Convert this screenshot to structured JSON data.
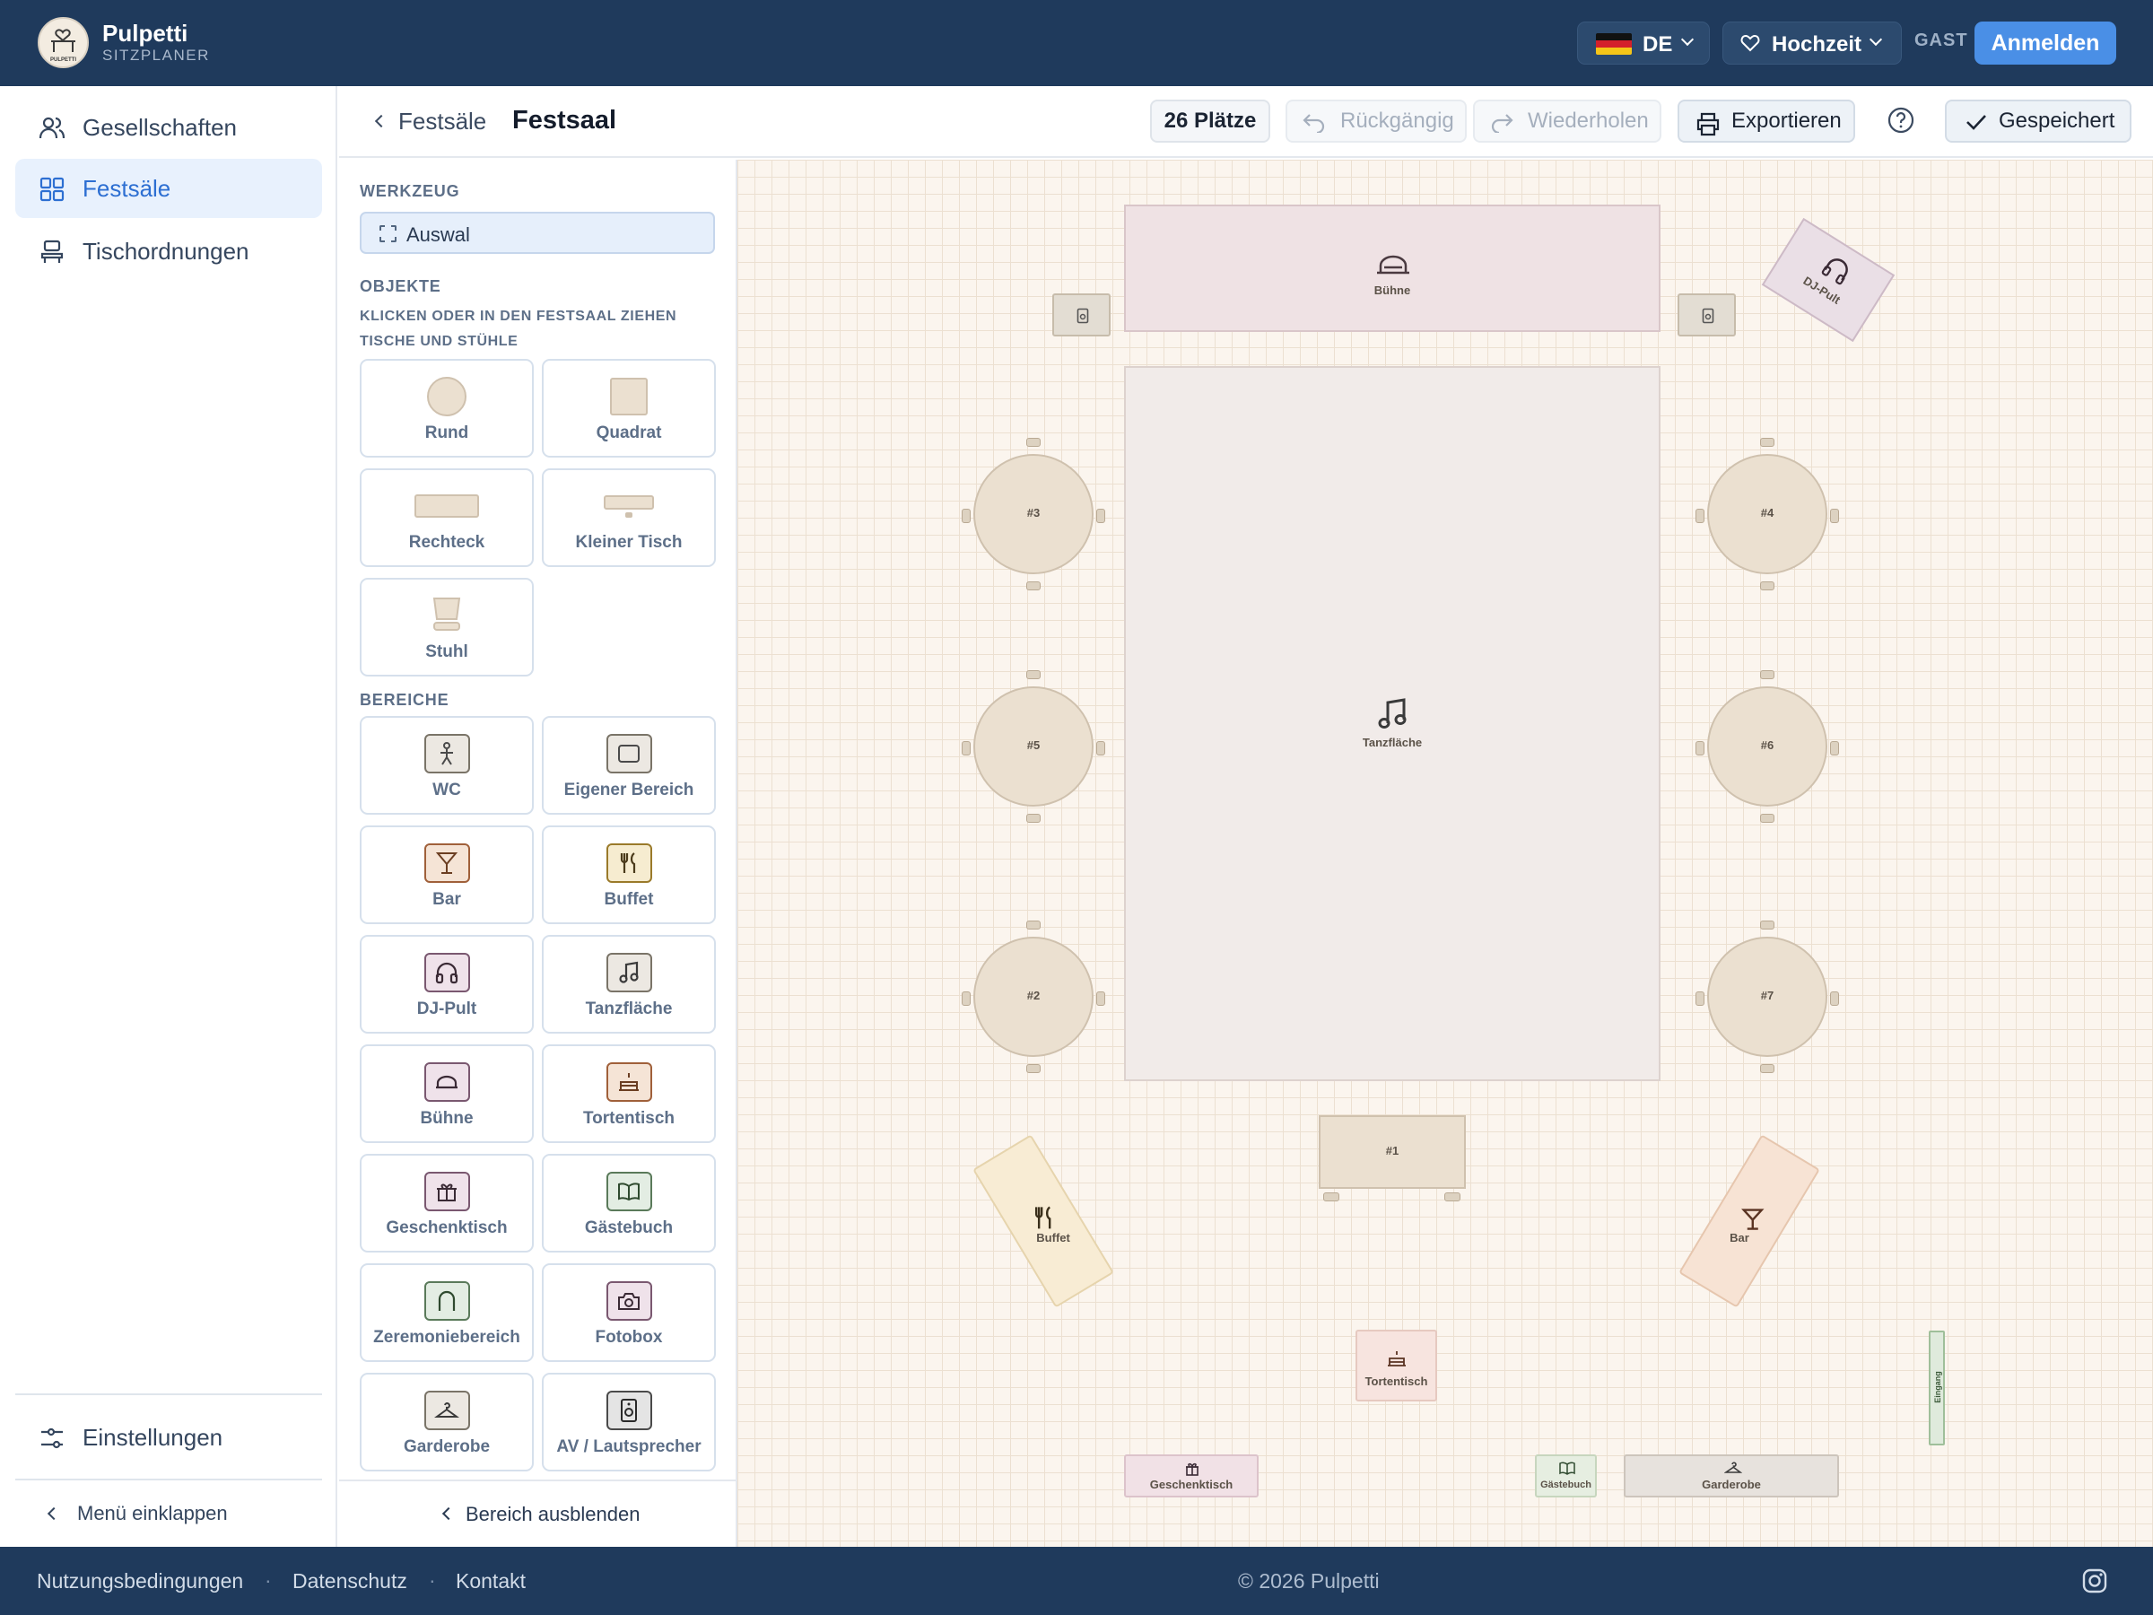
{
  "brand": {
    "name": "Pulpetti",
    "subtitle": "SITZPLANER",
    "logo_text": "PULPETTI"
  },
  "topbar": {
    "language": "DE",
    "event_type": "Hochzeit",
    "guest_label": "GAST",
    "login_label": "Anmelden"
  },
  "nav": {
    "items": [
      {
        "label": "Gesellschaften",
        "icon": "users-icon",
        "active": false
      },
      {
        "label": "Festsäle",
        "icon": "grid-icon",
        "active": true
      },
      {
        "label": "Tischordnungen",
        "icon": "chair-icon",
        "active": false
      }
    ],
    "settings_label": "Einstellungen",
    "collapse_label": "Menü einklappen"
  },
  "subheader": {
    "back_label": "Festsäle",
    "title": "Festsaal",
    "seats": "26 Plätze",
    "undo": "Rückgängig",
    "redo": "Wiederholen",
    "export": "Exportieren",
    "saved": "Gespeichert"
  },
  "tools": {
    "tool_title": "WERKZEUG",
    "selection": "Auswal",
    "objects_title": "OBJEKTE",
    "drag_hint": "KLICKEN ODER IN DEN FESTSAAL ZIEHEN",
    "tables_title": "TISCHE UND STÜHLE",
    "tables": [
      "Rund",
      "Quadrat",
      "Rechteck",
      "Kleiner Tisch",
      "Stuhl"
    ],
    "areas_title": "BEREICHE",
    "areas": [
      {
        "label": "WC",
        "icon": "wc-icon",
        "color": "#7a7468"
      },
      {
        "label": "Eigener Bereich",
        "icon": "square-icon",
        "color": "#7a7468"
      },
      {
        "label": "Bar",
        "icon": "cocktail-icon",
        "color": "#a0603a"
      },
      {
        "label": "Buffet",
        "icon": "cutlery-icon",
        "color": "#9a7a2a"
      },
      {
        "label": "DJ-Pult",
        "icon": "headphones-icon",
        "color": "#7a5870"
      },
      {
        "label": "Tanzfläche",
        "icon": "music-icon",
        "color": "#7a7468"
      },
      {
        "label": "Bühne",
        "icon": "stage-icon",
        "color": "#7a5870"
      },
      {
        "label": "Tortentisch",
        "icon": "cake-icon",
        "color": "#a0603a"
      },
      {
        "label": "Geschenktisch",
        "icon": "gift-icon",
        "color": "#7a5870"
      },
      {
        "label": "Gästebuch",
        "icon": "book-icon",
        "color": "#5a7a5a"
      },
      {
        "label": "Zeremoniebereich",
        "icon": "arch-icon",
        "color": "#5a7a5a"
      },
      {
        "label": "Fotobox",
        "icon": "camera-icon",
        "color": "#7a5870"
      },
      {
        "label": "Garderobe",
        "icon": "hanger-icon",
        "color": "#7a7468"
      },
      {
        "label": "AV / Lautsprecher",
        "icon": "speaker-icon",
        "color": "#4a4a4a"
      }
    ],
    "hide_label": "Bereich ausblenden"
  },
  "canvas": {
    "stage": "Bühne",
    "dj": "DJ-Pult",
    "dancefloor": "Tanzfläche",
    "tables": [
      "#3",
      "#4",
      "#5",
      "#6",
      "#2",
      "#7"
    ],
    "rect_table": "#1",
    "buffet": "Buffet",
    "bar": "Bar",
    "cake": "Tortentisch",
    "gifts": "Geschenktisch",
    "guestbook": "Gästebuch",
    "wardrobe": "Garderobe",
    "entrance": "Eingang"
  },
  "footer": {
    "terms": "Nutzungsbedingungen",
    "privacy": "Datenschutz",
    "contact": "Kontakt",
    "copyright": "© 2026 Pulpetti",
    "instagram_icon": "instagram-icon"
  },
  "colors": {
    "navy": "#1f3a5c",
    "accent": "#4a8fe6",
    "active_bg": "#e8f1fd"
  }
}
